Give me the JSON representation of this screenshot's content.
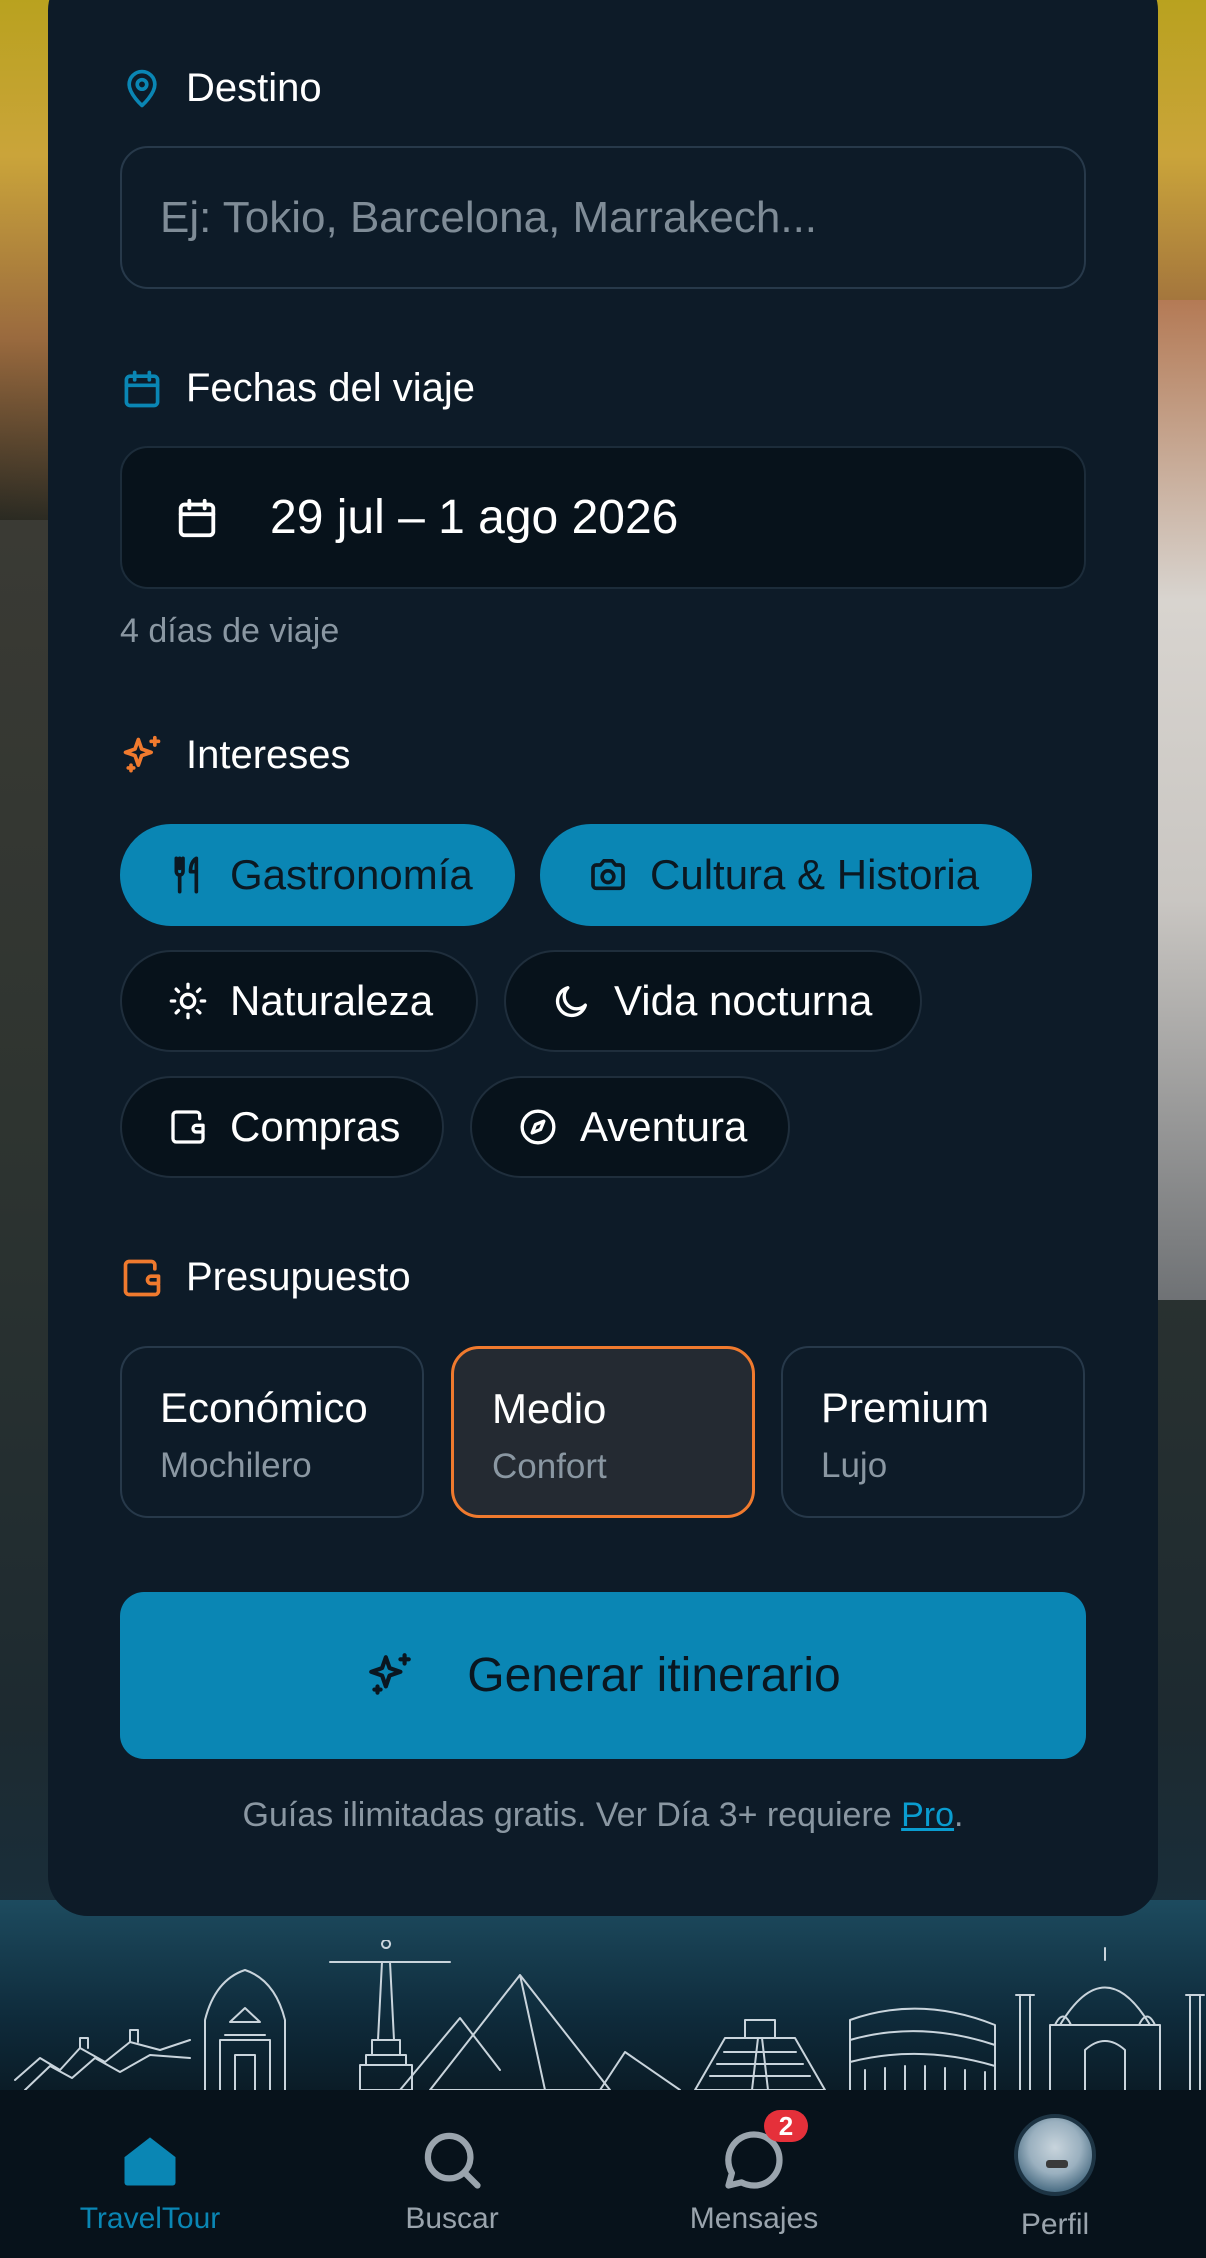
{
  "form": {
    "destination": {
      "label": "Destino",
      "placeholder": "Ej: Tokio, Barcelona, Marrakech...",
      "value": ""
    },
    "dates": {
      "label": "Fechas del viaje",
      "value": "29 jul – 1 ago 2026",
      "hint": "4 días de viaje"
    },
    "interests": {
      "label": "Intereses",
      "chips": [
        {
          "label": "Gastronomía",
          "selected": true,
          "icon": "utensils-icon"
        },
        {
          "label": "Cultura & Historia",
          "selected": true,
          "icon": "camera-icon"
        },
        {
          "label": "Naturaleza",
          "selected": false,
          "icon": "sun-icon"
        },
        {
          "label": "Vida nocturna",
          "selected": false,
          "icon": "moon-icon"
        },
        {
          "label": "Compras",
          "selected": false,
          "icon": "wallet-icon"
        },
        {
          "label": "Aventura",
          "selected": false,
          "icon": "compass-icon"
        }
      ]
    },
    "budget": {
      "label": "Presupuesto",
      "options": [
        {
          "title": "Económico",
          "subtitle": "Mochilero",
          "selected": false
        },
        {
          "title": "Medio",
          "subtitle": "Confort",
          "selected": true
        },
        {
          "title": "Premium",
          "subtitle": "Lujo",
          "selected": false
        }
      ]
    },
    "cta": {
      "label": "Generar itinerario"
    },
    "footnote": {
      "text": "Guías ilimitadas gratis. Ver Día 3+ requiere ",
      "link": "Pro",
      "end": "."
    }
  },
  "tabbar": {
    "tabs": [
      {
        "label": "TravelTour",
        "icon": "home-icon",
        "active": true
      },
      {
        "label": "Buscar",
        "icon": "search-icon",
        "active": false
      },
      {
        "label": "Mensajes",
        "icon": "chat-icon",
        "active": false,
        "badge": "2"
      },
      {
        "label": "Perfil",
        "icon": "avatar",
        "active": false
      }
    ]
  },
  "colors": {
    "accent": "#0a86b4",
    "budget_selected_border": "#f07a2e",
    "section_icon_blue": "#0a86b4",
    "section_icon_orange": "#f07a2e",
    "badge": "#e5303a"
  }
}
